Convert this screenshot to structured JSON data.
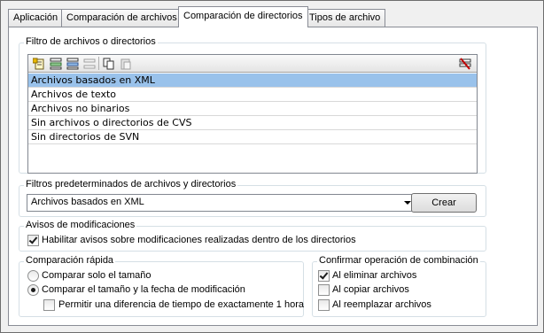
{
  "tabs": [
    {
      "label": "Aplicación"
    },
    {
      "label": "Comparación de archivos"
    },
    {
      "label": "Comparación de directorios"
    },
    {
      "label": "Tipos de archivo"
    }
  ],
  "active_tab": "Comparación de directorios",
  "filter_group": {
    "title": "Filtro de archivos o directorios",
    "toolbar": [
      "add-filter-icon",
      "insert-filter-icon",
      "edit-filter-icon",
      "delete-filter-icon",
      "copy-filter-icon",
      "paste-filter-icon",
      "reset-filters-icon"
    ],
    "items": [
      {
        "label": "Archivos basados en XML",
        "selected": true
      },
      {
        "label": "Archivos de texto",
        "selected": false
      },
      {
        "label": "Archivos no binarios",
        "selected": false
      },
      {
        "label": "Sin archivos o directorios de CVS",
        "selected": false
      },
      {
        "label": "Sin directorios de SVN",
        "selected": false
      }
    ]
  },
  "predefined_group": {
    "title": "Filtros predeterminados de archivos y directorios",
    "selected_value": "Archivos basados en XML",
    "create_label": "Crear"
  },
  "warnings_group": {
    "title": "Avisos de modificaciones",
    "checkbox_label": "Habilitar avisos sobre modificaciones realizadas dentro de los directorios",
    "checked": true
  },
  "quick_compare_group": {
    "title": "Comparación rápida",
    "option_size": "Comparar solo el tamaño",
    "option_size_date": "Comparar el tamaño y la fecha de modificación",
    "selected_option": "size_date",
    "tolerance_label": "Permitir una diferencia de tiempo de exactamente 1 hora",
    "tolerance_checked": false
  },
  "confirm_group": {
    "title": "Confirmar operación de combinación",
    "options": [
      {
        "label": "Al eliminar archivos",
        "checked": true
      },
      {
        "label": "Al copiar archivos",
        "checked": false
      },
      {
        "label": "Al reemplazar archivos",
        "checked": false
      }
    ]
  },
  "colors": {
    "selection": "#99c2eb",
    "panel_bg": "#ffffff",
    "window_bg": "#f0f0f0"
  }
}
